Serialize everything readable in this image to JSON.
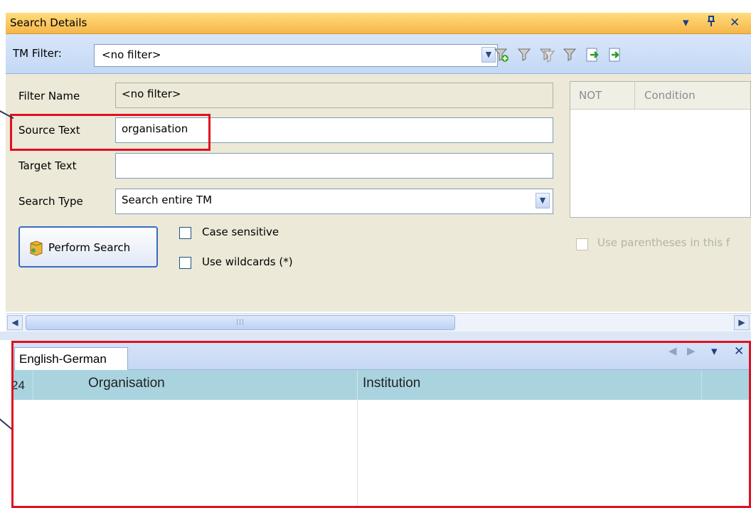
{
  "panel": {
    "title": "Search Details"
  },
  "title_controls": {
    "dropdown": "▾",
    "pin": "ᴾ",
    "close": "✕"
  },
  "toolbar": {
    "filter_label": "TM Filter:",
    "filter_value": "<no filter>",
    "icons": [
      "add-filter-icon",
      "edit-filter-icon",
      "copy-filter-icon",
      "delete-filter-icon",
      "export-filter-icon",
      "import-filter-icon"
    ]
  },
  "form": {
    "filter_name_label": "Filter Name",
    "filter_name_value": "<no filter>",
    "source_text_label": "Source Text",
    "source_text_value": "organisation",
    "target_text_label": "Target Text",
    "target_text_value": "",
    "search_type_label": "Search Type",
    "search_type_value": "Search entire TM",
    "perform_search_label": "Perform Search",
    "case_sensitive_label": "Case sensitive",
    "case_sensitive_checked": false,
    "use_wildcards_label": "Use wildcards (*)",
    "use_wildcards_checked": false
  },
  "conditions": {
    "columns": [
      "NOT",
      "Condition"
    ],
    "parentheses_label": "Use parentheses in this f"
  },
  "results": {
    "tab_label": "English-German",
    "rows": [
      {
        "index": "24",
        "source": "Organisation",
        "target": "Institution"
      }
    ]
  },
  "colors": {
    "title_bar": "#f6b64a",
    "toolbar": "#c4d8f5",
    "form_bg": "#ece9d8",
    "result_row": "#a9d4df",
    "annotation": "#e01020"
  }
}
